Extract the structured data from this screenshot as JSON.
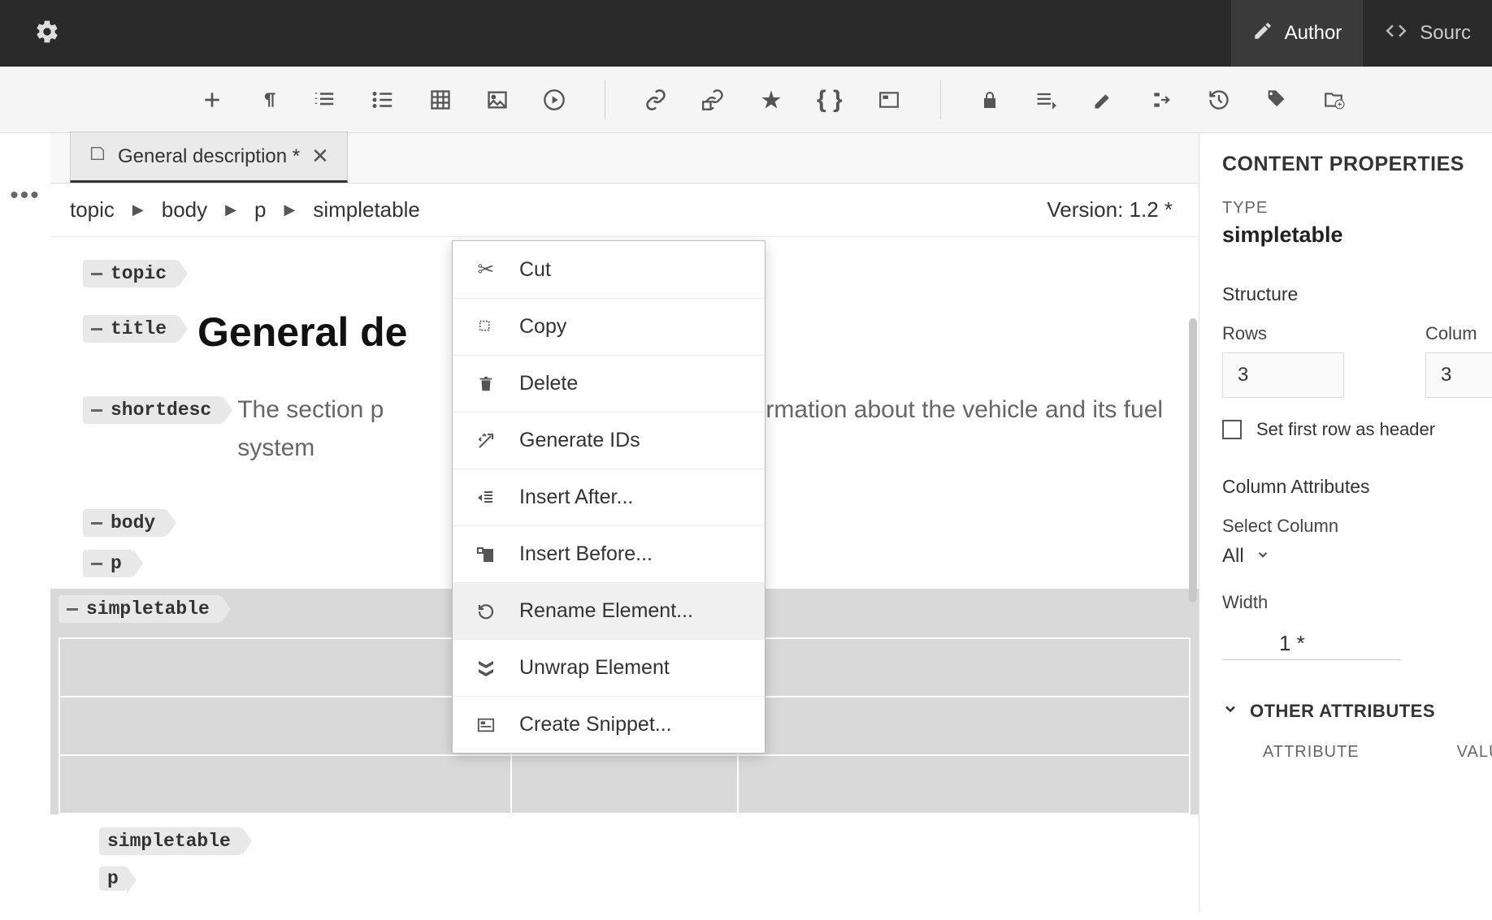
{
  "topbar": {
    "modes": {
      "author": "Author",
      "source": "Sourc"
    }
  },
  "tab": {
    "title": "General description *"
  },
  "breadcrumb": {
    "items": [
      "topic",
      "body",
      "p",
      "simpletable"
    ]
  },
  "version": "Version: 1.2 *",
  "doc": {
    "tags": {
      "topic": "topic",
      "title": "title",
      "shortdesc": "shortdesc",
      "body": "body",
      "p": "p",
      "simpletable": "simpletable",
      "simpletable2": "simpletable",
      "p2": "p"
    },
    "title_text": "General de",
    "shortdesc_pre": "The section p",
    "shortdesc_post": "nd information about the vehicle and its fuel system"
  },
  "contextmenu": {
    "items": [
      {
        "icon": "cut-icon",
        "label": "Cut"
      },
      {
        "icon": "copy-icon",
        "label": "Copy"
      },
      {
        "icon": "delete-icon",
        "label": "Delete"
      },
      {
        "icon": "generate-ids-icon",
        "label": "Generate IDs"
      },
      {
        "icon": "insert-after-icon",
        "label": "Insert After..."
      },
      {
        "icon": "insert-before-icon",
        "label": "Insert Before..."
      },
      {
        "icon": "rename-icon",
        "label": "Rename Element..."
      },
      {
        "icon": "unwrap-icon",
        "label": "Unwrap Element"
      },
      {
        "icon": "snippet-icon",
        "label": "Create Snippet..."
      }
    ],
    "hover_index": 6
  },
  "right_panel": {
    "title": "CONTENT PROPERTIES",
    "type_label": "TYPE",
    "type_value": "simpletable",
    "structure": {
      "heading": "Structure",
      "rows_label": "Rows",
      "rows_value": "3",
      "columns_label": "Colum",
      "columns_value": "3",
      "header_checkbox": "Set first row as header"
    },
    "column_attrs": {
      "heading": "Column Attributes",
      "select_label": "Select Column",
      "select_value": "All",
      "width_label": "Width",
      "width_value": "1 *"
    },
    "other": {
      "heading": "OTHER ATTRIBUTES",
      "col_attr": "ATTRIBUTE",
      "col_val": "VALU"
    }
  }
}
